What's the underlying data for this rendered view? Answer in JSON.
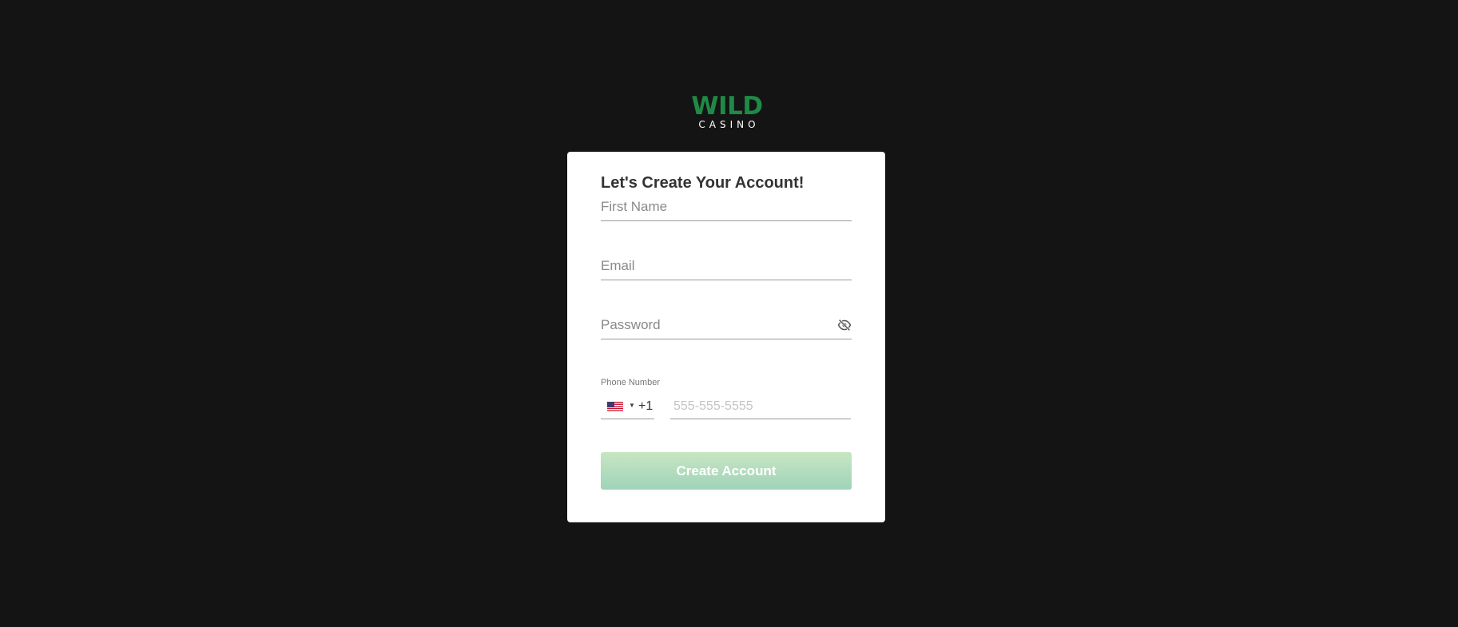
{
  "brand": {
    "logo_top": "WILD",
    "logo_bottom": "CASINO",
    "logo_color": "#1f8a45"
  },
  "form": {
    "title": "Let's Create Your Account!",
    "first_name": {
      "value": "",
      "placeholder": "First Name"
    },
    "email": {
      "value": "",
      "placeholder": "Email"
    },
    "password": {
      "value": "",
      "placeholder": "Password",
      "toggle_icon": "eye-slash-icon"
    },
    "phone": {
      "label": "Phone Number",
      "country_flag": "us-flag-icon",
      "dial_code": "+1",
      "value": "",
      "placeholder": "555-555-5555"
    },
    "submit_label": "Create Account"
  },
  "colors": {
    "background": "#141414",
    "card": "#ffffff",
    "button_gradient_top": "#c8e6c2",
    "button_gradient_bottom": "#9fd3b9"
  }
}
